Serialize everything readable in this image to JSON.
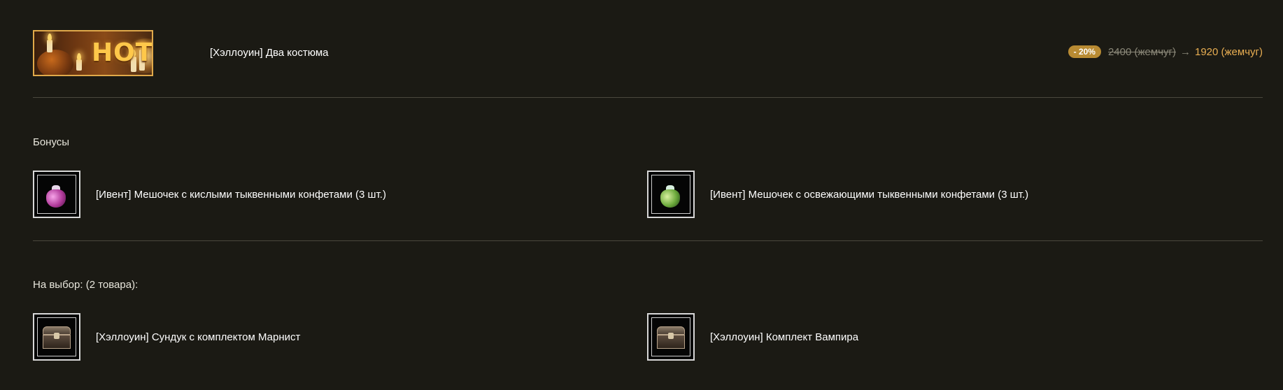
{
  "header": {
    "banner_text": "HOT",
    "title": "[Хэллоуин] Два костюма",
    "discount": "- 20%",
    "old_price": "2400 (жемчуг)",
    "arrow": "→",
    "new_price": "1920 (жемчуг)"
  },
  "bonuses": {
    "title": "Бонусы",
    "items": [
      {
        "label": "[Ивент] Мешочек с кислыми тыквенными конфетами (3 шт.)",
        "icon": "pink-candy-pouch-icon"
      },
      {
        "label": "[Ивент] Мешочек с освежающими тыквенными конфетами (3 шт.)",
        "icon": "green-candy-pouch-icon"
      }
    ]
  },
  "choice": {
    "title": "На выбор: (2 товара):",
    "items": [
      {
        "label": "[Хэллоуин] Сундук с комплектом Марнист",
        "icon": "chest-icon"
      },
      {
        "label": "[Хэллоуин] Комплект Вампира",
        "icon": "chest-icon"
      }
    ]
  },
  "colors": {
    "background": "#1b1a14",
    "accent": "#e8ae52",
    "badge": "#b98b33",
    "divider": "#4a483d",
    "banner_border": "#e0a94a"
  }
}
